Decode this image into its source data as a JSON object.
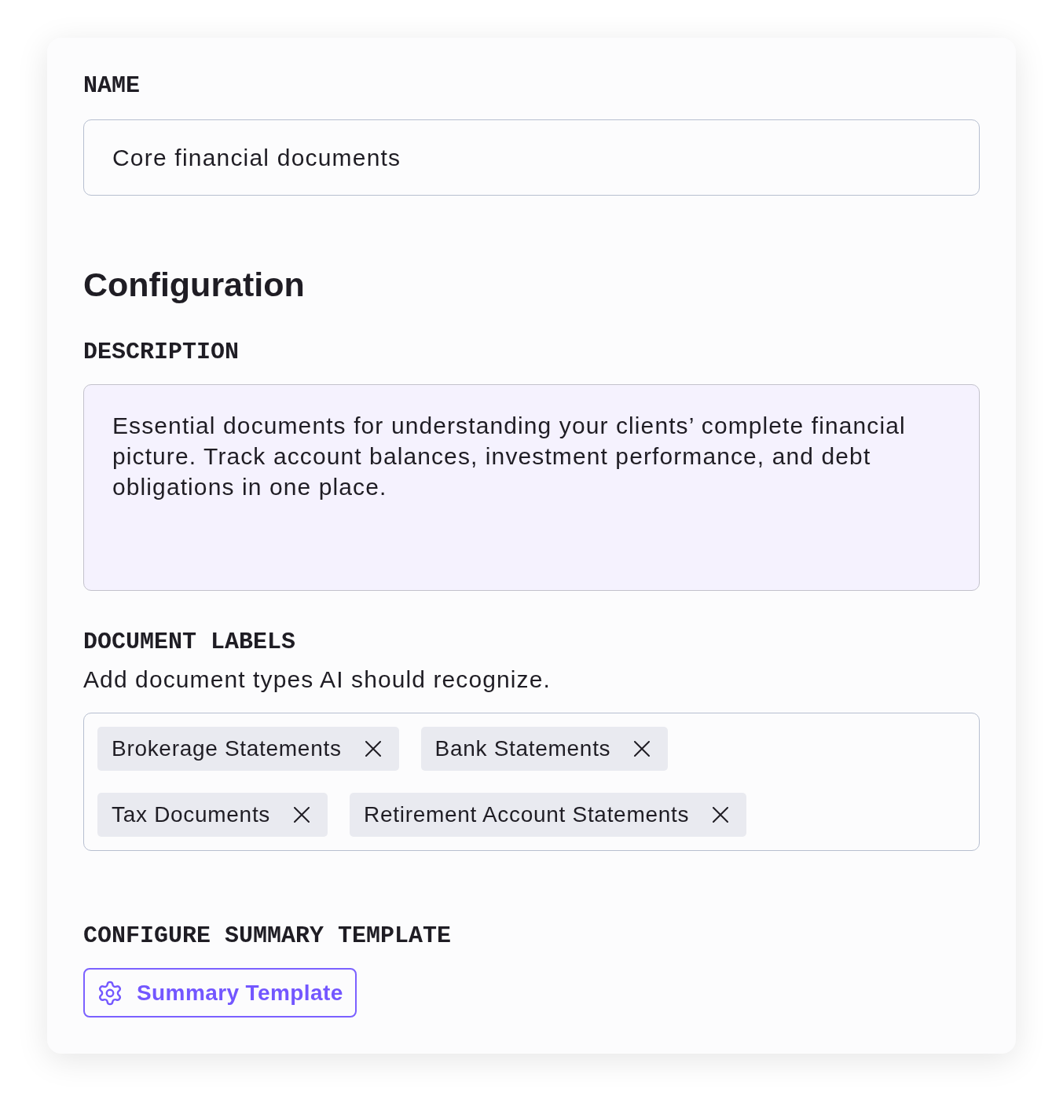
{
  "name_field": {
    "label": "NAME",
    "value": "Core financial documents"
  },
  "configuration": {
    "title": "Configuration",
    "description": {
      "label": "DESCRIPTION",
      "value": "Essential documents for understanding your clients’ complete financial picture. Track account balances, investment performance, and debt obligations in one place."
    },
    "document_labels": {
      "label": "DOCUMENT LABELS",
      "helper_text": "Add document types AI should recognize.",
      "tags": [
        {
          "label": "Brokerage Statements"
        },
        {
          "label": "Bank Statements"
        },
        {
          "label": "Tax Documents"
        },
        {
          "label": "Retirement Account Statements"
        }
      ]
    },
    "summary_template": {
      "label": "CONFIGURE SUMMARY TEMPLATE",
      "button": "Summary Template"
    }
  }
}
